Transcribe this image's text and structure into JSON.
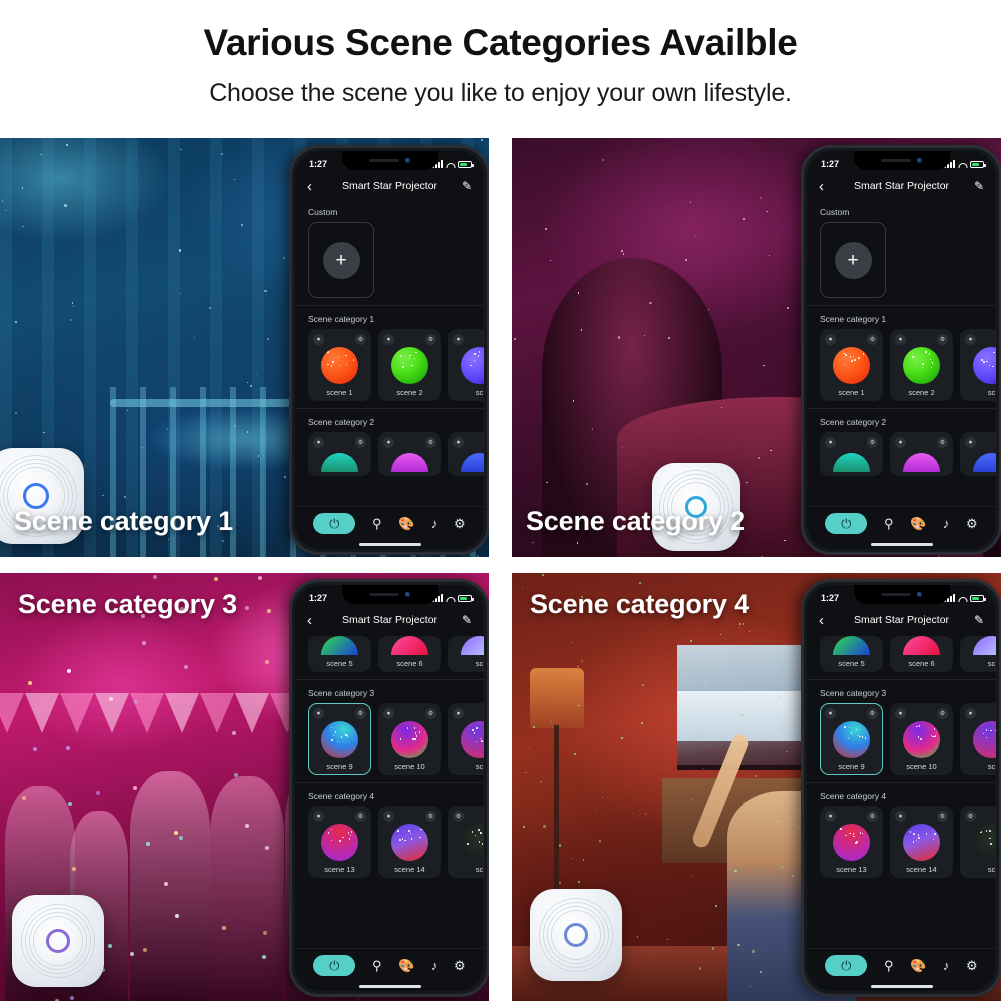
{
  "header": {
    "title": "Various Scene Categories Availble",
    "subtitle": "Choose the scene you like to enjoy your own lifestyle."
  },
  "colors": {
    "accent_teal": "#57cfc9",
    "selection_border": "#5ec9c4",
    "phone_bg": "#0e1013",
    "card_bg": "#1b1e22",
    "battery_green": "#3ddc6a"
  },
  "panels": [
    {
      "caption": "Scene category 1",
      "caption_position": "bottom-left",
      "photo_description": "starry blue nursery with crib and projector device",
      "phone": {
        "view": "top"
      }
    },
    {
      "caption": "Scene category 2",
      "caption_position": "bottom-left",
      "photo_description": "couple at romantic dinner with pink neon light",
      "phone": {
        "view": "top"
      }
    },
    {
      "caption": "Scene category 3",
      "caption_position": "top-left",
      "photo_description": "people dancing at magenta lit party with bunting",
      "phone": {
        "view": "scrolled"
      }
    },
    {
      "caption": "Scene category 4",
      "caption_position": "top-left",
      "photo_description": "woman watching sports on tv with red nebula light",
      "phone": {
        "view": "scrolled"
      }
    }
  ],
  "phone_app": {
    "status_bar": {
      "time": "1:27",
      "location_icon": "location-arrow-icon",
      "signal_icon": "signal-bars-icon",
      "wifi_icon": "wifi-icon",
      "battery_icon": "battery-icon"
    },
    "app_bar": {
      "back_icon": "chevron-left-icon",
      "title": "Smart Star Projector",
      "edit_icon": "pencil-icon"
    },
    "custom": {
      "label": "Custom",
      "add_label": "+"
    },
    "badges": {
      "speed_icon": "speed-icon",
      "brightness_icon": "brightness-icon"
    },
    "nav": {
      "power_icon": "power-icon",
      "light_icon": "bulb-icon",
      "scene_icon": "palette-icon",
      "music_icon": "music-note-icon",
      "settings_icon": "gear-icon"
    },
    "view_top": {
      "sections": [
        {
          "label": "Scene category 1",
          "cards": [
            {
              "label": "scene 1",
              "style": "sphere",
              "colors": [
                "#ff5c1a",
                "#e8250a"
              ]
            },
            {
              "label": "scene 2",
              "style": "sphere",
              "colors": [
                "#4ee01a",
                "#0f9e05"
              ]
            },
            {
              "label": "sc",
              "style": "sphere",
              "colors": [
                "#6a52ff",
                "#3a1fd6"
              ]
            }
          ]
        },
        {
          "label": "Scene category 2",
          "cards": [
            {
              "label": "scene 5",
              "style": "half",
              "colors": [
                "#1fd6c0",
                "#1a8f6e"
              ]
            },
            {
              "label": "scene 6",
              "style": "half",
              "colors": [
                "#e85cf0",
                "#b32ad6"
              ]
            },
            {
              "label": "sc",
              "style": "half",
              "colors": [
                "#4b6bff",
                "#2a3fd6"
              ]
            }
          ]
        }
      ]
    },
    "view_scrolled": {
      "sections": [
        {
          "label": "",
          "cards": [
            {
              "label": "scene 5",
              "style": "half",
              "colors": [
                "#2fe04a",
                "#1a3fd6"
              ]
            },
            {
              "label": "scene 6",
              "style": "half",
              "colors": [
                "#ff4ba0",
                "#e61040"
              ]
            },
            {
              "label": "sc",
              "style": "half",
              "colors": [
                "#8a6bff",
                "#c9d4ff"
              ]
            }
          ]
        },
        {
          "label": "Scene category 3",
          "selected_index": 0,
          "cards": [
            {
              "label": "scene 9",
              "style": "sphere",
              "colors": [
                "#2f7fe6",
                "#3ad6d6",
                "#e62a2a"
              ]
            },
            {
              "label": "scene 10",
              "style": "sphere",
              "colors": [
                "#7a2ae6",
                "#e62a8a",
                "#2ad63a"
              ]
            },
            {
              "label": "sc",
              "style": "sphere",
              "colors": [
                "#6a3ae6",
                "#e62a5a"
              ]
            }
          ]
        },
        {
          "label": "Scene category 4",
          "cards": [
            {
              "label": "scene 13",
              "style": "sphere",
              "colors": [
                "#e62a4a",
                "#a02ae6"
              ]
            },
            {
              "label": "scene 14",
              "style": "sphere",
              "colors": [
                "#5a3ae6",
                "#e62a2a"
              ]
            },
            {
              "label": "sc",
              "style": "sphere",
              "colors": [
                "#1a1d21",
                "#2a3d2a"
              ]
            }
          ]
        }
      ]
    }
  }
}
